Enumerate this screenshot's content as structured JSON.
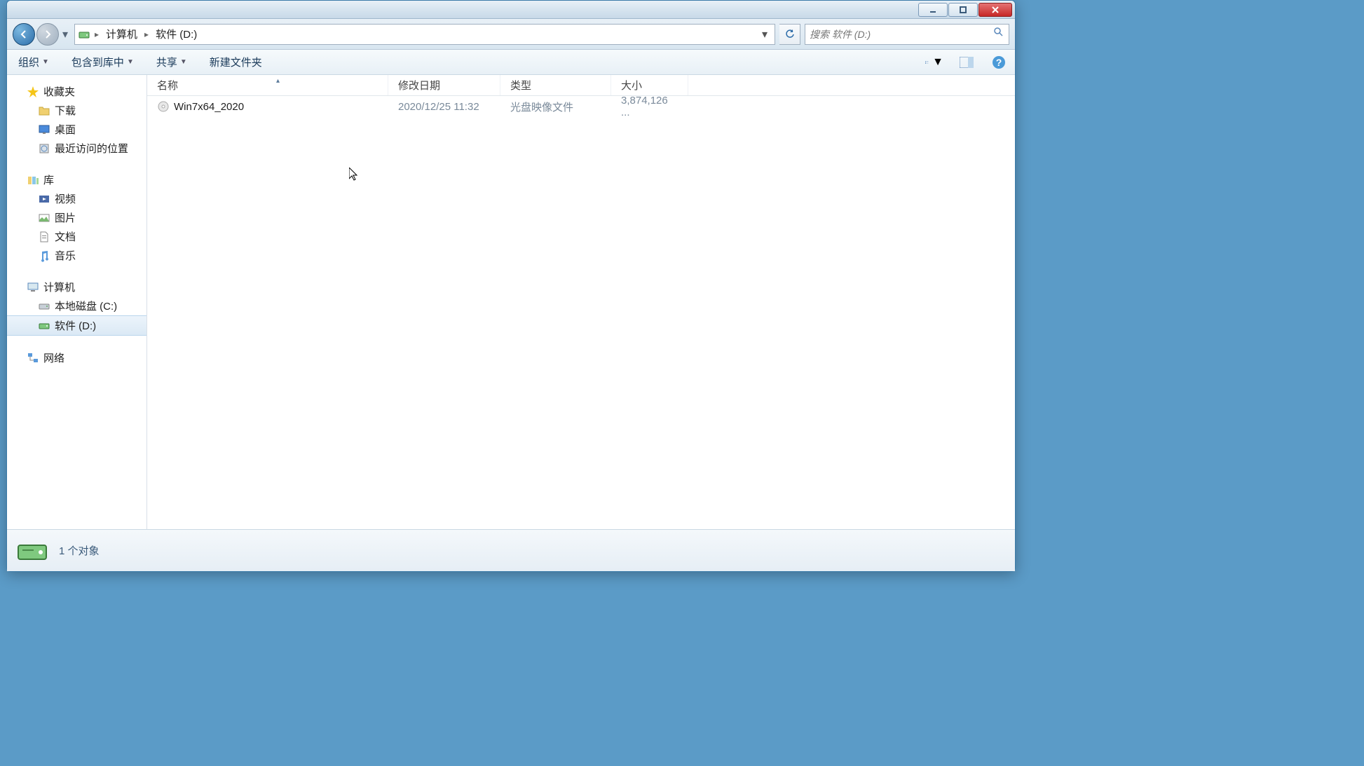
{
  "breadcrumb": {
    "computer": "计算机",
    "drive": "软件 (D:)"
  },
  "search": {
    "placeholder": "搜索 软件 (D:)"
  },
  "toolbar": {
    "organize": "组织",
    "include": "包含到库中",
    "share": "共享",
    "newfolder": "新建文件夹"
  },
  "columns": {
    "name": "名称",
    "date": "修改日期",
    "type": "类型",
    "size": "大小"
  },
  "sidebar": {
    "favorites": "收藏夹",
    "downloads": "下载",
    "desktop": "桌面",
    "recent": "最近访问的位置",
    "libraries": "库",
    "videos": "视频",
    "pictures": "图片",
    "documents": "文档",
    "music": "音乐",
    "computer": "计算机",
    "localc": "本地磁盘 (C:)",
    "softd": "软件 (D:)",
    "network": "网络"
  },
  "files": [
    {
      "name": "Win7x64_2020",
      "date": "2020/12/25 11:32",
      "type": "光盘映像文件",
      "size": "3,874,126 ..."
    }
  ],
  "status": {
    "count": "1 个对象"
  }
}
